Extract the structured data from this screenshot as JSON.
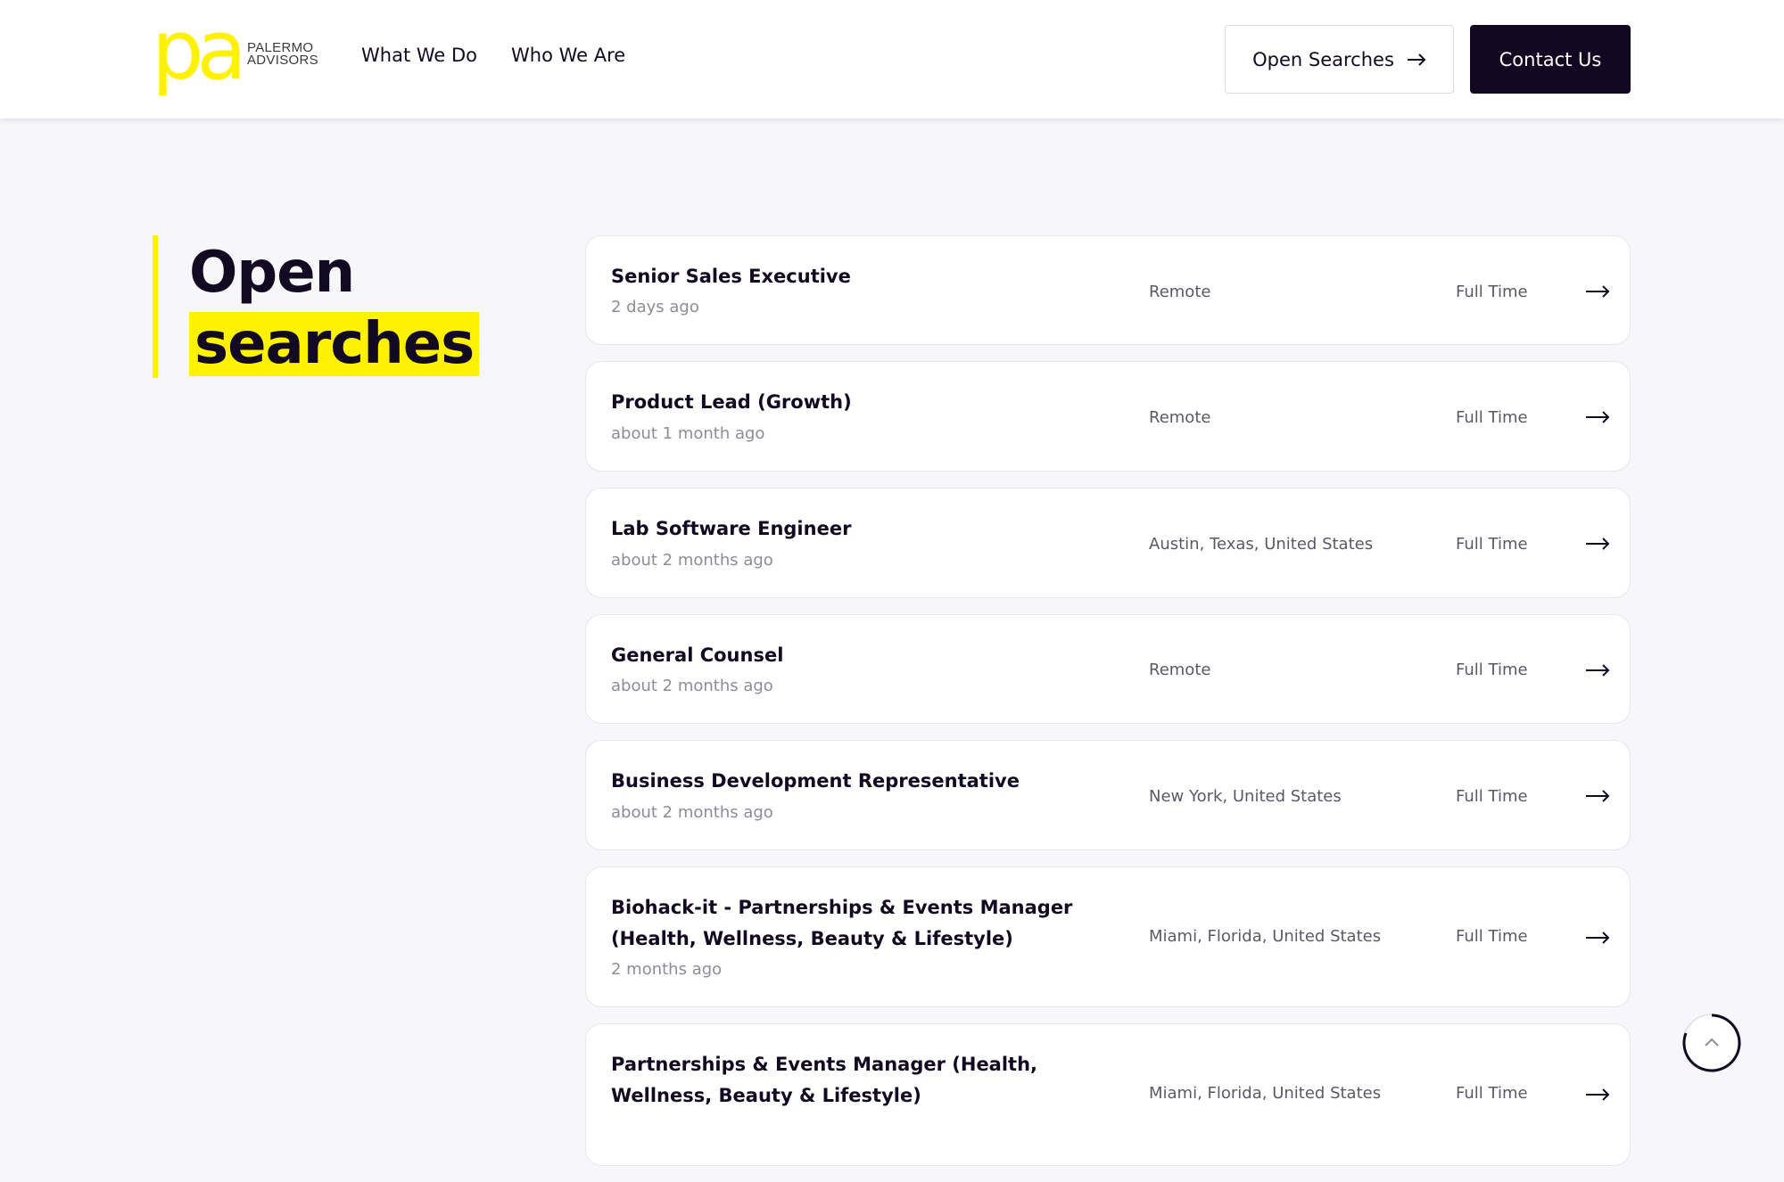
{
  "brand": {
    "logo_letters": "pa",
    "name_line1": "PALERMO",
    "name_line2": "ADVISORS",
    "accent_color": "#fff200",
    "dark_color": "#130822"
  },
  "nav": {
    "links": [
      "What We Do",
      "Who We Are"
    ],
    "open_searches_label": "Open Searches",
    "open_searches_icon": "arrow-right-icon",
    "contact_label": "Contact Us"
  },
  "page": {
    "title_line1": "Open",
    "title_line2": "searches"
  },
  "jobs": [
    {
      "title": "Senior Sales Executive",
      "posted": "2 days ago",
      "location": "Remote",
      "type": "Full Time"
    },
    {
      "title": "Product Lead (Growth)",
      "posted": "about 1 month ago",
      "location": "Remote",
      "type": "Full Time"
    },
    {
      "title": "Lab Software Engineer",
      "posted": "about 2 months ago",
      "location": "Austin, Texas, United States",
      "type": "Full Time"
    },
    {
      "title": "General Counsel",
      "posted": "about 2 months ago",
      "location": "Remote",
      "type": "Full Time"
    },
    {
      "title": "Business Development Representative",
      "posted": "about 2 months ago",
      "location": "New York, United States",
      "type": "Full Time"
    },
    {
      "title": "Biohack-it - Partnerships & Events Manager (Health, Wellness, Beauty & Lifestyle)",
      "posted": "2 months ago",
      "location": "Miami, Florida, United States",
      "type": "Full Time"
    },
    {
      "title": "Partnerships & Events Manager (Health, Wellness, Beauty & Lifestyle)",
      "posted": "",
      "location": "Miami, Florida, United States",
      "type": "Full Time"
    }
  ],
  "scroll_top_icon": "chevron-up-icon"
}
